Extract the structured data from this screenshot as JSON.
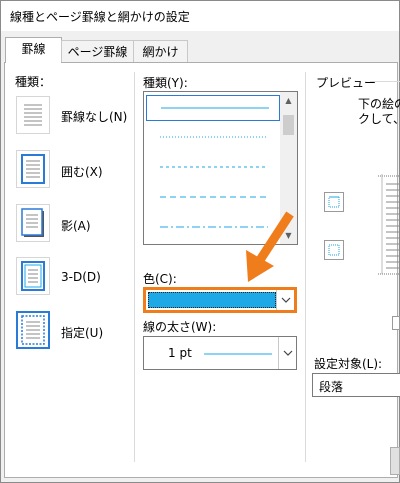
{
  "window": {
    "title": "線種とページ罫線と網かけの設定"
  },
  "tabs": [
    {
      "label": "罫線",
      "active": true
    },
    {
      "label": "ページ罫線",
      "active": false
    },
    {
      "label": "網かけ",
      "active": false
    }
  ],
  "settings": {
    "heading": "種類：",
    "items": [
      {
        "label": "罫線なし(N)",
        "icon": "border-none-icon"
      },
      {
        "label": "囲む(X)",
        "icon": "border-box-icon"
      },
      {
        "label": "影(A)",
        "icon": "border-shadow-icon"
      },
      {
        "label": "3-D(D)",
        "icon": "border-3d-icon"
      },
      {
        "label": "指定(U)",
        "icon": "border-custom-icon",
        "selected": true
      }
    ]
  },
  "style": {
    "heading": "種類(Y):",
    "items": [
      {
        "name": "solid",
        "selected": true
      },
      {
        "name": "dotted"
      },
      {
        "name": "dashed-small"
      },
      {
        "name": "dashed"
      },
      {
        "name": "dash-dot"
      }
    ]
  },
  "color": {
    "heading": "色(C):",
    "value_hex": "#1ea8e6",
    "highlight_hex": "#f07d1c",
    "arrow_hex": "#f07d1c"
  },
  "width": {
    "heading": "線の太さ(W):",
    "value": "1 pt"
  },
  "preview": {
    "heading": "プレビュー",
    "text_line1": "下の絵の",
    "text_line2": "クして、"
  },
  "apply_to": {
    "heading": "設定対象(L):",
    "value": "段落"
  },
  "colors": {
    "accent": "#2a7ad8",
    "line": "#1ea8e6"
  }
}
